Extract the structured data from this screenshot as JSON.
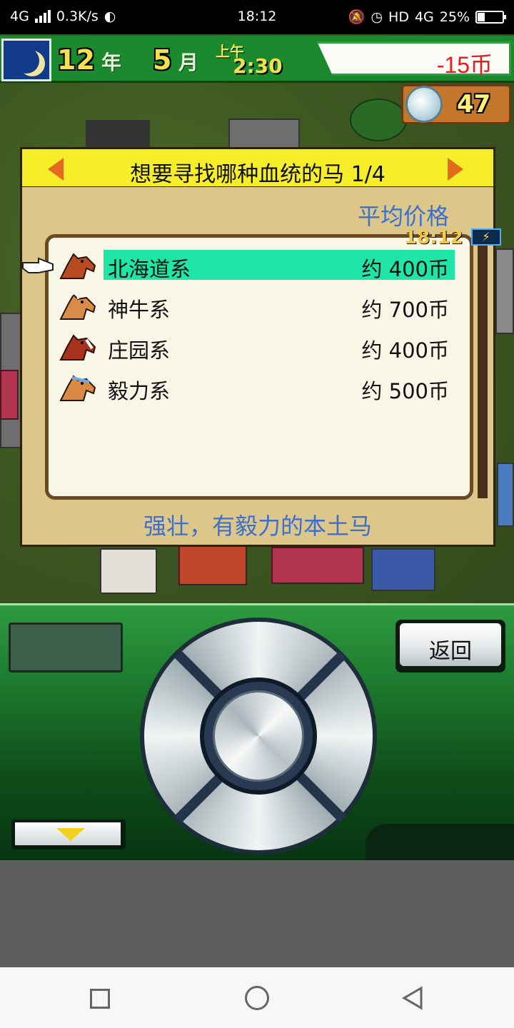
{
  "status_bar": {
    "network": "4G",
    "speed": "0.3K/s",
    "time": "18:12",
    "hd": "HD",
    "network_right": "4G",
    "battery": "25%"
  },
  "hud": {
    "year_num": "12",
    "year_unit": "年",
    "month_num": "5",
    "month_unit": "月",
    "am_pm": "上午",
    "clock": "2:30",
    "money": "-15币",
    "medals": "47"
  },
  "dialog": {
    "title": "想要寻找哪种血统的马 1/4",
    "avg_price_label": "平均价格",
    "description": "强壮，有毅力的本土马",
    "items": [
      {
        "name": "北海道系",
        "price": "约 400币",
        "horse_color": "#b84a24",
        "selected": true
      },
      {
        "name": "神牛系",
        "price": "约 700币",
        "horse_color": "#d88c4a",
        "selected": false
      },
      {
        "name": "庄园系",
        "price": "约 400币",
        "horse_color": "#a8321e",
        "selected": false
      },
      {
        "name": "毅力系",
        "price": "约 500币",
        "horse_color": "#d98a44",
        "selected": false
      }
    ]
  },
  "controller": {
    "back_label": "返回",
    "clock": "18:12"
  },
  "colors": {
    "accent_green": "#1b8a2e",
    "title_yellow": "#f7ee2a",
    "highlight": "#1fe6a6",
    "blue_text": "#3b6fd0",
    "money_red": "#e81c1c"
  }
}
